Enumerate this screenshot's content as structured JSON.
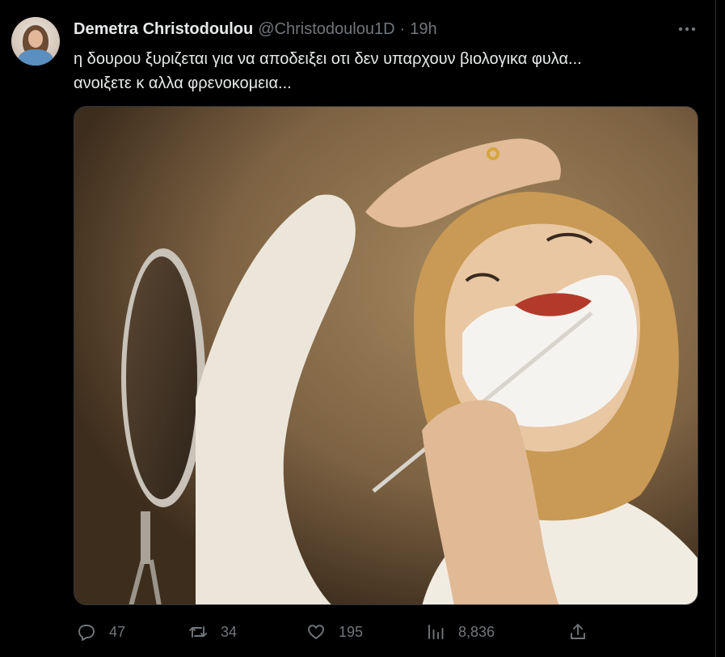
{
  "author": {
    "name": "Demetra Christodoulou",
    "handle": "@Christodoulou1D",
    "separator": "·",
    "time": "19h"
  },
  "more_icon": "more-horizontal-icon",
  "tweet": {
    "line1": "η δουρου ξυριζεται για να αποδειξει οτι δεν υπαρχουν βιολογικα φυλα...",
    "line2": "ανοιξετε κ αλλα φρενοκομεια..."
  },
  "actions": {
    "replies": "47",
    "retweets": "34",
    "likes": "195",
    "views": "8,836"
  },
  "icons": {
    "reply": "reply-icon",
    "retweet": "retweet-icon",
    "like": "heart-icon",
    "views": "views-chart-icon",
    "share": "share-icon"
  },
  "colors": {
    "background": "#000000",
    "text": "#e7e9ea",
    "muted": "#71767b",
    "border": "#2f3336"
  }
}
